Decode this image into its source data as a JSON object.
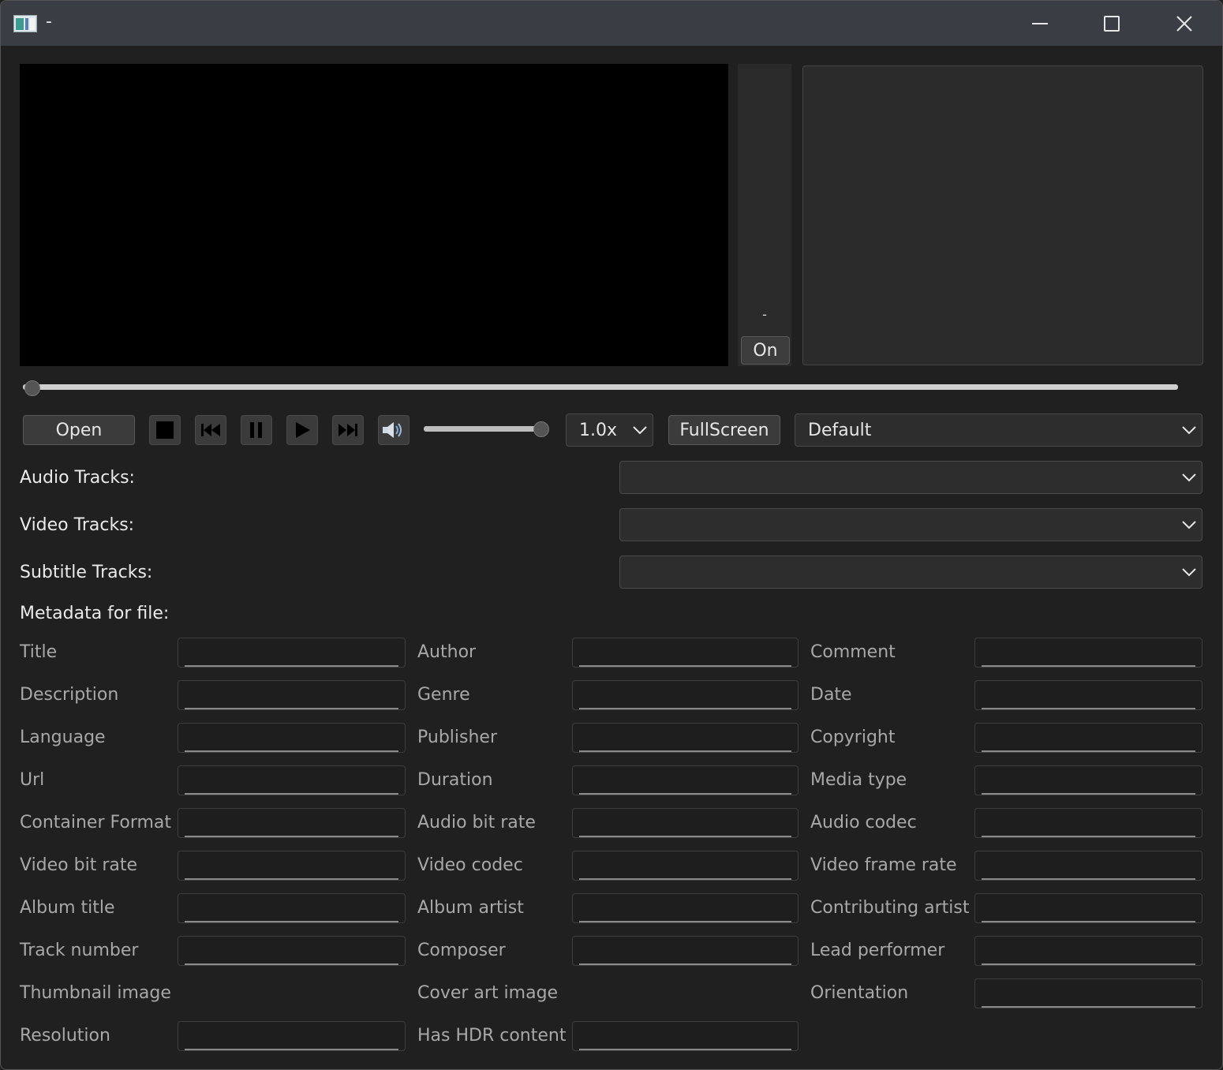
{
  "window": {
    "title": "-"
  },
  "side": {
    "dash": "-",
    "on_label": "On"
  },
  "controls": {
    "open_label": "Open",
    "fullscreen_label": "FullScreen",
    "speed": "1.0x",
    "aspect": "Default",
    "seek_position": 0.0,
    "volume": 1.0
  },
  "tracks": {
    "audio_label": "Audio Tracks:",
    "video_label": "Video Tracks:",
    "subtitle_label": "Subtitle Tracks:",
    "audio_value": "",
    "video_value": "",
    "subtitle_value": ""
  },
  "metadata": {
    "section_label": "Metadata for file:",
    "col1": [
      "Title",
      "Description",
      "Language",
      "Url",
      "Container Format",
      "Video bit rate",
      "Album title",
      "Track number",
      "Thumbnail image",
      "Resolution"
    ],
    "col2": [
      "Author",
      "Genre",
      "Publisher",
      "Duration",
      "Audio bit rate",
      "Video codec",
      "Album artist",
      "Composer",
      "Cover art image",
      "Has HDR content"
    ],
    "col3": [
      "Comment",
      "Date",
      "Copyright",
      "Media type",
      "Audio codec",
      "Video frame rate",
      "Contributing artist",
      "Lead performer",
      "Orientation"
    ]
  }
}
